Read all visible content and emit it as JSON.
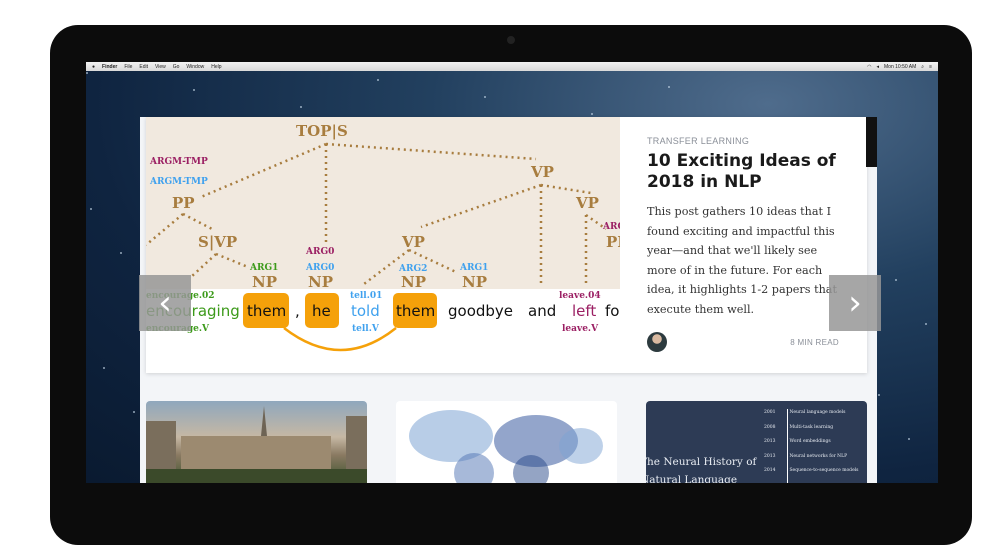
{
  "menubar": {
    "apple": "",
    "items": [
      "Finder",
      "File",
      "Edit",
      "View",
      "Go",
      "Window",
      "Help"
    ],
    "clock": "Mon 10:50 AM"
  },
  "hero": {
    "category": "TRANSFER LEARNING",
    "title": "10 Exciting Ideas of 2018 in NLP",
    "excerpt": "This post gathers 10 ideas that I found exciting and impactful this year—and that we'll likely see more of in the future. For each idea, it highlights 1-2 papers that execute them well.",
    "read_time": "8 MIN READ",
    "prev_icon": "chevron-left-icon",
    "next_icon": "chevron-right-icon",
    "diagram": {
      "nodes": {
        "top": "TOP|S",
        "pp": "PP",
        "svp": "S|VP",
        "vp1": "VP",
        "vp2": "VP",
        "vp3": "VP",
        "np1": "NP",
        "np2": "NP",
        "np3": "NP",
        "np4": "NP",
        "pr": "PP"
      },
      "roles": {
        "argm_tmp1": "ARGM-TMP",
        "argm_tmp2": "ARGM-TMP",
        "arg1a": "ARG1",
        "arg0a": "ARG0",
        "arg0b": "ARG0",
        "arg2": "ARG2",
        "arg1b": "ARG1",
        "argr": "ARG"
      },
      "words": [
        "encouraging",
        "them",
        ",",
        "he",
        "told",
        "them",
        "goodbye",
        "and",
        "left",
        "fo"
      ],
      "senses": {
        "enc_top": "encourage.02",
        "enc_bot": "encourage.V",
        "tell_top": "tell.01",
        "tell_bot": "tell.V",
        "leave_top": "leave.04",
        "leave_bot": "leave.V"
      }
    }
  },
  "cards": [
    {
      "type": "photo"
    },
    {
      "type": "word-cloud"
    },
    {
      "title": "The Neural History of Natural Language Processing",
      "timeline": [
        [
          "2001",
          "Neural language models"
        ],
        [
          "2008",
          "Multi-task learning"
        ],
        [
          "2013",
          "Word embeddings"
        ],
        [
          "2013",
          "Neural networks for NLP"
        ],
        [
          "2014",
          "Sequence-to-sequence models"
        ]
      ]
    }
  ],
  "colors": {
    "tree": "#a87d3f",
    "purple": "#9b1f63",
    "blue": "#3fa1ee",
    "green": "#3c9a1a",
    "orange": "#f5a10a",
    "card_navy": "#2d3b55"
  }
}
